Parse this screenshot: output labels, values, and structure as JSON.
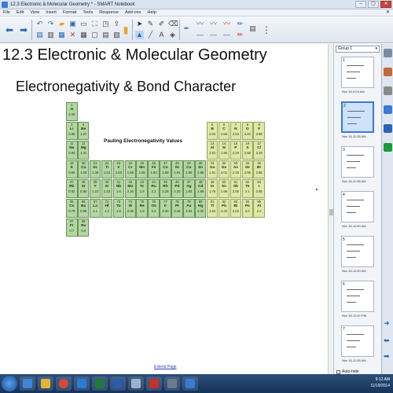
{
  "window": {
    "title": "12.3 Electronic & Molecular Geometry * - SMART Notebook"
  },
  "menu": [
    "File",
    "Edit",
    "View",
    "Insert",
    "Format",
    "Tools",
    "Response",
    "Add-ons",
    "Help"
  ],
  "toolbar": {
    "tools": [
      "back-icon",
      "forward-icon",
      "undo-icon",
      "redo-icon",
      "delete-icon",
      "screen-shade-icon",
      "table-icon",
      "fullscreen-icon",
      "select-icon",
      "pen-icon",
      "eraser-icon",
      "line-icon",
      "shape-icon",
      "fill-icon",
      "text-icon",
      "properties-icon"
    ]
  },
  "page": {
    "heading": "12.3 Electronic & Molecular Geometry",
    "slide_title": "Electronegativity & Bond Character",
    "link": "Extend Page"
  },
  "periodic_table": {
    "title": "Pauling Electronegativity Values",
    "elements": [
      {
        "n": "1",
        "s": "H",
        "en": "2.20",
        "c": 0,
        "r": 0,
        "t": "s"
      },
      {
        "n": "3",
        "s": "Li",
        "en": "0.98",
        "c": 0,
        "r": 1,
        "t": "s"
      },
      {
        "n": "4",
        "s": "Be",
        "en": "1.57",
        "c": 1,
        "r": 1,
        "t": "s"
      },
      {
        "n": "11",
        "s": "Na",
        "en": "0.93",
        "c": 0,
        "r": 2,
        "t": "s"
      },
      {
        "n": "12",
        "s": "Mg",
        "en": "1.31",
        "c": 1,
        "r": 2,
        "t": "s"
      },
      {
        "n": "19",
        "s": "K",
        "en": "0.82",
        "c": 0,
        "r": 3,
        "t": "s"
      },
      {
        "n": "20",
        "s": "Ca",
        "en": "1.00",
        "c": 1,
        "r": 3,
        "t": "s"
      },
      {
        "n": "21",
        "s": "Sc",
        "en": "1.36",
        "c": 2,
        "r": 3,
        "t": "s"
      },
      {
        "n": "22",
        "s": "Ti",
        "en": "1.54",
        "c": 3,
        "r": 3,
        "t": "s"
      },
      {
        "n": "23",
        "s": "V",
        "en": "1.63",
        "c": 4,
        "r": 3,
        "t": "s"
      },
      {
        "n": "24",
        "s": "Cr",
        "en": "1.66",
        "c": 5,
        "r": 3,
        "t": "s"
      },
      {
        "n": "25",
        "s": "Mn",
        "en": "1.55",
        "c": 6,
        "r": 3,
        "t": "s"
      },
      {
        "n": "26",
        "s": "Fe",
        "en": "1.83",
        "c": 7,
        "r": 3,
        "t": "s"
      },
      {
        "n": "27",
        "s": "Co",
        "en": "1.88",
        "c": 8,
        "r": 3,
        "t": "s"
      },
      {
        "n": "28",
        "s": "Ni",
        "en": "1.91",
        "c": 9,
        "r": 3,
        "t": "s"
      },
      {
        "n": "29",
        "s": "Cu",
        "en": "1.90",
        "c": 10,
        "r": 3,
        "t": "s"
      },
      {
        "n": "30",
        "s": "Zn",
        "en": "1.65",
        "c": 11,
        "r": 3,
        "t": "s"
      },
      {
        "n": "37",
        "s": "Rb",
        "en": "0.82",
        "c": 0,
        "r": 4,
        "t": "s"
      },
      {
        "n": "38",
        "s": "Sr",
        "en": "0.95",
        "c": 1,
        "r": 4,
        "t": "s"
      },
      {
        "n": "39",
        "s": "Y",
        "en": "1.22",
        "c": 2,
        "r": 4,
        "t": "s"
      },
      {
        "n": "40",
        "s": "Zr",
        "en": "1.33",
        "c": 3,
        "r": 4,
        "t": "s"
      },
      {
        "n": "41",
        "s": "Nb",
        "en": "1.6",
        "c": 4,
        "r": 4,
        "t": "s"
      },
      {
        "n": "42",
        "s": "Mo",
        "en": "2.16",
        "c": 5,
        "r": 4,
        "t": "s"
      },
      {
        "n": "43",
        "s": "Tc",
        "en": "1.9",
        "c": 6,
        "r": 4,
        "t": "s"
      },
      {
        "n": "44",
        "s": "Ru",
        "en": "2.2",
        "c": 7,
        "r": 4,
        "t": "s"
      },
      {
        "n": "45",
        "s": "Rh",
        "en": "2.28",
        "c": 8,
        "r": 4,
        "t": "s"
      },
      {
        "n": "46",
        "s": "Pd",
        "en": "2.20",
        "c": 9,
        "r": 4,
        "t": "s"
      },
      {
        "n": "47",
        "s": "Ag",
        "en": "1.93",
        "c": 10,
        "r": 4,
        "t": "s"
      },
      {
        "n": "48",
        "s": "Cd",
        "en": "1.69",
        "c": 11,
        "r": 4,
        "t": "s"
      },
      {
        "n": "55",
        "s": "Cs",
        "en": "0.79",
        "c": 0,
        "r": 5,
        "t": "s"
      },
      {
        "n": "56",
        "s": "Ba",
        "en": "0.89",
        "c": 1,
        "r": 5,
        "t": "s"
      },
      {
        "n": "57",
        "s": "La",
        "en": "1.1",
        "c": 2,
        "r": 5,
        "t": "s"
      },
      {
        "n": "72",
        "s": "Hf",
        "en": "1.3",
        "c": 3,
        "r": 5,
        "t": "s"
      },
      {
        "n": "73",
        "s": "Ta",
        "en": "1.5",
        "c": 4,
        "r": 5,
        "t": "s"
      },
      {
        "n": "74",
        "s": "W",
        "en": "2.36",
        "c": 5,
        "r": 5,
        "t": "s"
      },
      {
        "n": "75",
        "s": "Re",
        "en": "1.9",
        "c": 6,
        "r": 5,
        "t": "s"
      },
      {
        "n": "76",
        "s": "Os",
        "en": "2.2",
        "c": 7,
        "r": 5,
        "t": "s"
      },
      {
        "n": "77",
        "s": "Ir",
        "en": "2.20",
        "c": 8,
        "r": 5,
        "t": "s"
      },
      {
        "n": "78",
        "s": "Pt",
        "en": "2.28",
        "c": 9,
        "r": 5,
        "t": "s"
      },
      {
        "n": "79",
        "s": "Au",
        "en": "2.54",
        "c": 10,
        "r": 5,
        "t": "s"
      },
      {
        "n": "80",
        "s": "Hg",
        "en": "2.00",
        "c": 11,
        "r": 5,
        "t": "s"
      },
      {
        "n": "87",
        "s": "Fr",
        "en": "0.7",
        "c": 0,
        "r": 6,
        "t": "s"
      },
      {
        "n": "88",
        "s": "Ra",
        "en": "0.9",
        "c": 1,
        "r": 6,
        "t": "s"
      },
      {
        "n": "5",
        "s": "B",
        "en": "2.04",
        "c": 12,
        "r": 1,
        "t": "p"
      },
      {
        "n": "6",
        "s": "C",
        "en": "2.55",
        "c": 13,
        "r": 1,
        "t": "p"
      },
      {
        "n": "7",
        "s": "N",
        "en": "3.04",
        "c": 14,
        "r": 1,
        "t": "p"
      },
      {
        "n": "8",
        "s": "O",
        "en": "3.44",
        "c": 15,
        "r": 1,
        "t": "p"
      },
      {
        "n": "9",
        "s": "F",
        "en": "3.98",
        "c": 16,
        "r": 1,
        "t": "p"
      },
      {
        "n": "13",
        "s": "Al",
        "en": "1.61",
        "c": 12,
        "r": 2,
        "t": "p"
      },
      {
        "n": "14",
        "s": "Si",
        "en": "1.90",
        "c": 13,
        "r": 2,
        "t": "p"
      },
      {
        "n": "15",
        "s": "P",
        "en": "2.19",
        "c": 14,
        "r": 2,
        "t": "p"
      },
      {
        "n": "16",
        "s": "S",
        "en": "2.58",
        "c": 15,
        "r": 2,
        "t": "p"
      },
      {
        "n": "17",
        "s": "Cl",
        "en": "3.16",
        "c": 16,
        "r": 2,
        "t": "p"
      },
      {
        "n": "31",
        "s": "Ga",
        "en": "1.81",
        "c": 12,
        "r": 3,
        "t": "p"
      },
      {
        "n": "32",
        "s": "Ge",
        "en": "2.01",
        "c": 13,
        "r": 3,
        "t": "p"
      },
      {
        "n": "33",
        "s": "As",
        "en": "2.18",
        "c": 14,
        "r": 3,
        "t": "p"
      },
      {
        "n": "34",
        "s": "Se",
        "en": "2.55",
        "c": 15,
        "r": 3,
        "t": "p"
      },
      {
        "n": "35",
        "s": "Br",
        "en": "2.96",
        "c": 16,
        "r": 3,
        "t": "p"
      },
      {
        "n": "49",
        "s": "In",
        "en": "1.78",
        "c": 12,
        "r": 4,
        "t": "p"
      },
      {
        "n": "50",
        "s": "Sn",
        "en": "1.96",
        "c": 13,
        "r": 4,
        "t": "p"
      },
      {
        "n": "51",
        "s": "Sb",
        "en": "2.05",
        "c": 14,
        "r": 4,
        "t": "p"
      },
      {
        "n": "52",
        "s": "Te",
        "en": "2.1",
        "c": 15,
        "r": 4,
        "t": "p"
      },
      {
        "n": "53",
        "s": "I",
        "en": "2.66",
        "c": 16,
        "r": 4,
        "t": "p"
      },
      {
        "n": "81",
        "s": "Tl",
        "en": "1.62",
        "c": 12,
        "r": 5,
        "t": "p"
      },
      {
        "n": "82",
        "s": "Pb",
        "en": "2.33",
        "c": 13,
        "r": 5,
        "t": "p"
      },
      {
        "n": "83",
        "s": "Bi",
        "en": "2.02",
        "c": 14,
        "r": 5,
        "t": "p"
      },
      {
        "n": "84",
        "s": "Po",
        "en": "2.0",
        "c": 15,
        "r": 5,
        "t": "p"
      },
      {
        "n": "85",
        "s": "At",
        "en": "2.2",
        "c": 16,
        "r": 5,
        "t": "p"
      }
    ]
  },
  "page_sorter": {
    "group": "Group 1",
    "pages": [
      {
        "num": "1",
        "date": "Nov 16-9:04 AM"
      },
      {
        "num": "2",
        "date": "Nov 16-11:35 AM"
      },
      {
        "num": "3",
        "date": "Nov 16-11:38 AM"
      },
      {
        "num": "4",
        "date": "Nov 16-11:50 AM"
      },
      {
        "num": "5",
        "date": "Nov 16-11:50 AM"
      },
      {
        "num": "6",
        "date": "Nov 16-12:07 PM"
      },
      {
        "num": "7",
        "date": "Nov 16-11:55 AM"
      }
    ],
    "autohide": "Auto-hide"
  },
  "sidebar_icons": [
    "page-sorter-icon",
    "gallery-icon",
    "attachments-icon",
    "properties-icon",
    "add-ons-icon",
    "smart-response-icon"
  ],
  "taskbar": {
    "apps": [
      "ie-icon",
      "explorer-icon",
      "chrome-icon",
      "media-icon",
      "excel-icon",
      "word-icon",
      "network-icon",
      "acrobat-icon",
      "camera-icon",
      "smart-notebook-icon"
    ],
    "time": "9:12 AM",
    "date": "11/19/2014"
  },
  "colors": {
    "s_block": "#b3d7a1",
    "p_block": "#dde8a6",
    "titlebar": "#d9e4f1",
    "taskbar": "#1f3f66",
    "selection": "#3a7bd5"
  }
}
